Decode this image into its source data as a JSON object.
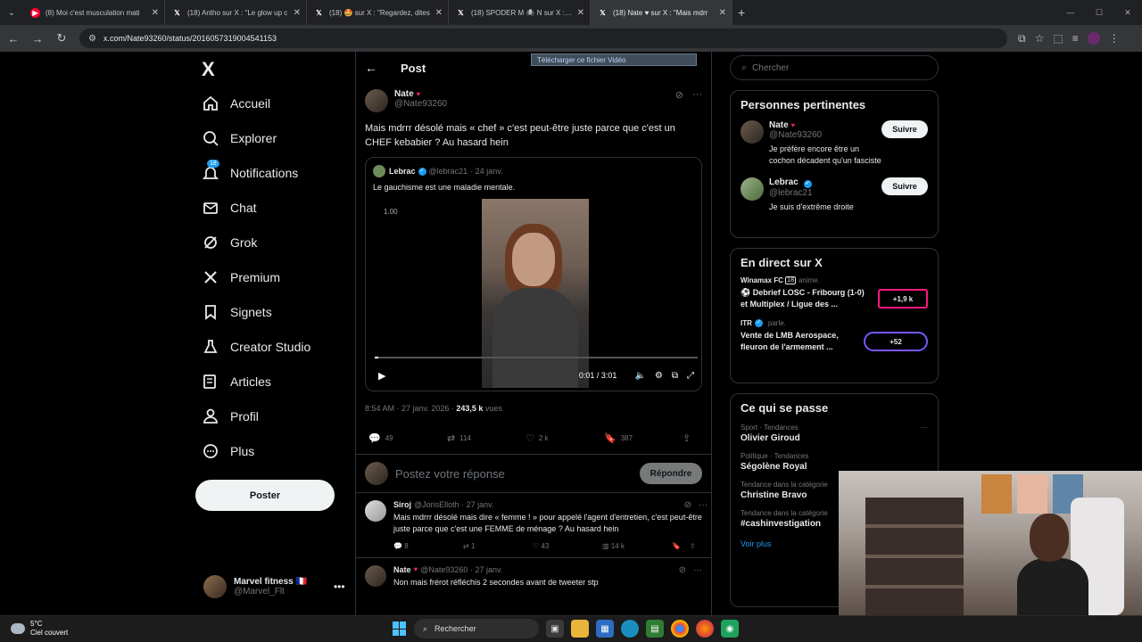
{
  "browser": {
    "tabs": [
      {
        "title": "(8) Moi c'est musculation mati",
        "favicon_color": "#ff0033"
      },
      {
        "title": "(18) Antho sur X : \"Le glow up c",
        "favicon_color": "#000000"
      },
      {
        "title": "(18) 🤩 sur X : \"Regardez, dites",
        "favicon_color": "#000000"
      },
      {
        "title": "(18) SPODER M 🕷 N sur X : \"Ah",
        "favicon_color": "#000000"
      },
      {
        "title": "(18) Nate ♥ sur X : \"Mais mdrr",
        "favicon_color": "#000000",
        "active": true
      }
    ],
    "url": "x.com/Nate93260/status/2016057319004541153"
  },
  "sidebar": {
    "logo": "X",
    "items": [
      {
        "label": "Accueil",
        "icon": "home-icon"
      },
      {
        "label": "Explorer",
        "icon": "search-icon"
      },
      {
        "label": "Notifications",
        "icon": "bell-icon",
        "badge": "18"
      },
      {
        "label": "Chat",
        "icon": "mail-icon"
      },
      {
        "label": "Grok",
        "icon": "grok-icon"
      },
      {
        "label": "Premium",
        "icon": "x-icon"
      },
      {
        "label": "Signets",
        "icon": "bookmark-icon"
      },
      {
        "label": "Creator Studio",
        "icon": "flask-icon"
      },
      {
        "label": "Articles",
        "icon": "article-icon"
      },
      {
        "label": "Profil",
        "icon": "person-icon"
      },
      {
        "label": "Plus",
        "icon": "more-circle-icon"
      }
    ],
    "post_button": "Poster",
    "account": {
      "name": "Marvel fitness 🇫🇷",
      "handle": "@Marvel_Flt"
    }
  },
  "main": {
    "header_title": "Post",
    "download_banner": "Télécharger ce fichier Vidéo",
    "author": {
      "name": "Nate",
      "handle": "@Nate93260"
    },
    "text": "Mais mdrrr désolé mais « chef » c'est peut-être juste parce que c'est un CHEF kebabier ? Au hasard hein",
    "quote": {
      "name": "Lebrac",
      "handle": "@lebrac21",
      "date": "· 24 janv.",
      "text": "Le gauchisme est une maladie mentale.",
      "video": {
        "speed": "1.00",
        "time": "0:01 / 3:01",
        "progress": 0.01
      }
    },
    "meta": {
      "time": "8:54 AM · 27 janv. 2026 · ",
      "views": "243,5 k",
      "views_label": " vues"
    },
    "stats": {
      "replies": "49",
      "reposts": "114",
      "likes": "2 k",
      "bookmarks": "387"
    },
    "reply_placeholder": "Postez votre réponse",
    "reply_button": "Répondre",
    "replies": [
      {
        "name": "Siroj",
        "handle": "@JorisElloth · 27 janv.",
        "text": "Mais mdrrr désolé mais dire « femme ! » pour appelé l'agent d'entretien, c'est peut-être juste parce que c'est une FEMME de ménage ? Au hasard hein",
        "replies": "8",
        "reposts": "1",
        "likes": "43",
        "views": "14 k"
      },
      {
        "name": "Nate",
        "handle": "@Nate93260 · 27 janv.",
        "text": "Non mais frérot réfléchis 2 secondes avant de tweeter stp"
      }
    ]
  },
  "right": {
    "search_placeholder": "Chercher",
    "relevant_title": "Personnes pertinentes",
    "people": [
      {
        "name": "Nate",
        "handle": "@Nate93260",
        "bio": "Je préfère encore être un cochon décadent qu'un fasciste",
        "button": "Suivre"
      },
      {
        "name": "Lebrac",
        "handle": "@lebrac21",
        "bio": "Je suis d'extrême droite",
        "button": "Suivre"
      }
    ],
    "live_title": "En direct sur X",
    "live": [
      {
        "source": "Winamax FC",
        "source_extra": "18",
        "verb": "anime.",
        "title": "⚽ Debrief LOSC - Fribourg (1-0) et Multiplex / Ligue des ...",
        "count": "+1,9 k"
      },
      {
        "source": "ITR",
        "verb": "parle.",
        "title": "Vente de LMB Aerospace, fleuron de l'armement ...",
        "count": "+52"
      }
    ],
    "trends_title": "Ce qui se passe",
    "trends": [
      {
        "category": "Sport · Tendances",
        "name": "Olivier Giroud"
      },
      {
        "category": "Politique · Tendances",
        "name": "Ségolène Royal"
      },
      {
        "category": "Tendance dans la catégorie",
        "name": "Christine Bravo"
      },
      {
        "category": "Tendance dans la catégorie",
        "name": "#cashinvestigation"
      }
    ],
    "see_more": "Voir plus"
  },
  "taskbar": {
    "weather_temp": "5°C",
    "weather_desc": "Ciel couvert",
    "search": "Rechercher"
  }
}
